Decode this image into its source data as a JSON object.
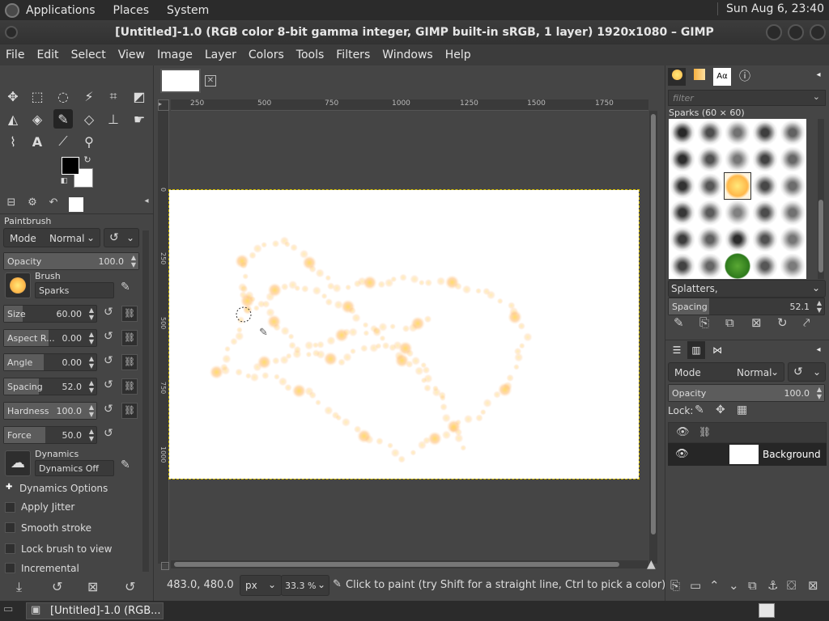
{
  "panel": {
    "menus": [
      "Applications",
      "Places",
      "System"
    ],
    "clock": "Sun Aug  6, 23:40"
  },
  "window": {
    "title": "[Untitled]-1.0 (RGB color 8-bit gamma integer, GIMP built-in sRGB, 1 layer) 1920x1080 – GIMP"
  },
  "menubar": [
    "File",
    "Edit",
    "Select",
    "View",
    "Image",
    "Layer",
    "Colors",
    "Tools",
    "Filters",
    "Windows",
    "Help"
  ],
  "tool_options": {
    "title": "Paintbrush",
    "mode_label": "Mode",
    "mode_value": "Normal",
    "opacity_label": "Opacity",
    "opacity_value": "100.0",
    "opacity_fraction": 1.0,
    "brush_label": "Brush",
    "brush_value": "Sparks",
    "size_label": "Size",
    "size_value": "60.00",
    "aspect_label": "Aspect R...",
    "aspect_value": "0.00",
    "angle_label": "Angle",
    "angle_value": "0.00",
    "spacing_label": "Spacing",
    "spacing_value": "52.0",
    "hardness_label": "Hardness",
    "hardness_value": "100.0",
    "force_label": "Force",
    "force_value": "50.0",
    "dynamics_label": "Dynamics",
    "dynamics_value": "Dynamics Off",
    "dynamics_options": "Dynamics Options",
    "apply_jitter": "Apply Jitter",
    "smooth_stroke": "Smooth stroke",
    "lock_brush": "Lock brush to view",
    "incremental": "Incremental"
  },
  "ruler": {
    "h_ticks": [
      "250",
      "500",
      "750",
      "1000",
      "1250",
      "1500",
      "1750"
    ],
    "v_ticks": [
      "0",
      "250",
      "500",
      "750",
      "1000"
    ]
  },
  "status": {
    "coords": "483.0, 480.0",
    "unit": "px",
    "zoom": "33.3 %",
    "message": "Click to paint (try Shift for a straight line, Ctrl to pick a color)"
  },
  "brushes": {
    "filter_placeholder": "filter",
    "title": "Sparks (60 × 60)",
    "tag": "Splatters,",
    "spacing_label": "Spacing",
    "spacing_value": "52.1"
  },
  "layers": {
    "mode_label": "Mode",
    "mode_value": "Normal",
    "opacity_label": "Opacity",
    "opacity_value": "100.0",
    "lock_label": "Lock:",
    "layer_name": "Background"
  },
  "taskbar": {
    "item": "[Untitled]-1.0 (RGB..."
  },
  "colors": {
    "accent": "#ffd84a"
  }
}
